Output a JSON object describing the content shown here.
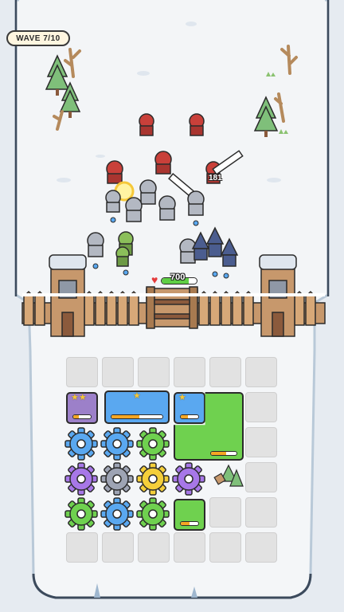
{
  "hud": {
    "wave_label": "WAVE 7/10",
    "gate_hp": "700",
    "gate_hp_fraction": 0.78,
    "damage_popup": "181"
  },
  "colors": {
    "snow": "#f4f6f8",
    "ice_border": "#c9d6e2",
    "wood": "#c7986c",
    "gear_blue": "#5aa8f0",
    "gear_purple": "#a777e8",
    "gear_green": "#6fd14f",
    "gear_yellow": "#f5cf3a",
    "gear_gray": "#9ea4b4",
    "unit_purple": "#9c80c9",
    "unit_blue": "#5aa8f0",
    "unit_green": "#6fd14f"
  },
  "board": {
    "gears": [
      {
        "color": "gear_blue"
      },
      {
        "color": "gear_blue"
      },
      {
        "color": "gear_green"
      },
      {
        "color": "gear_purple"
      },
      {
        "color": "gear_gray"
      },
      {
        "color": "gear_yellow"
      },
      {
        "color": "gear_purple"
      },
      {
        "color": "gear_green"
      },
      {
        "color": "gear_blue"
      },
      {
        "color": "gear_green"
      }
    ],
    "units": [
      {
        "type": "knight-card",
        "stars": "★★",
        "progress": 0.3
      },
      {
        "type": "archer-card",
        "stars": "★",
        "progress": 0.55
      },
      {
        "type": "sword-card",
        "stars": "★",
        "progress": 0.4
      },
      {
        "type": "sword-card",
        "stars": "",
        "progress": 0.6
      },
      {
        "type": "sword-card",
        "stars": "",
        "progress": 0.5
      }
    ]
  }
}
